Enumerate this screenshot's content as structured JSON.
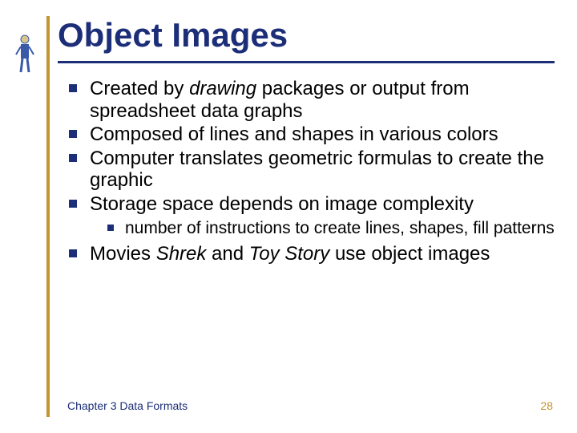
{
  "title": "Object Images",
  "bullets": {
    "b1a": "Created by ",
    "b1b": "drawing",
    "b1c": " packages or output from spreadsheet data graphs",
    "b2": "Composed of lines and shapes in various colors",
    "b3": "Computer translates geometric formulas to create the graphic",
    "b4": "Storage space depends on image complexity",
    "b4s1": "number of instructions to create lines, shapes, fill patterns",
    "b5a": "Movies ",
    "b5b": "Shrek",
    "b5c": " and ",
    "b5d": "Toy Story",
    "b5e": " use object images"
  },
  "footer": {
    "chapter": "Chapter 3 Data Formats",
    "page": "28"
  }
}
